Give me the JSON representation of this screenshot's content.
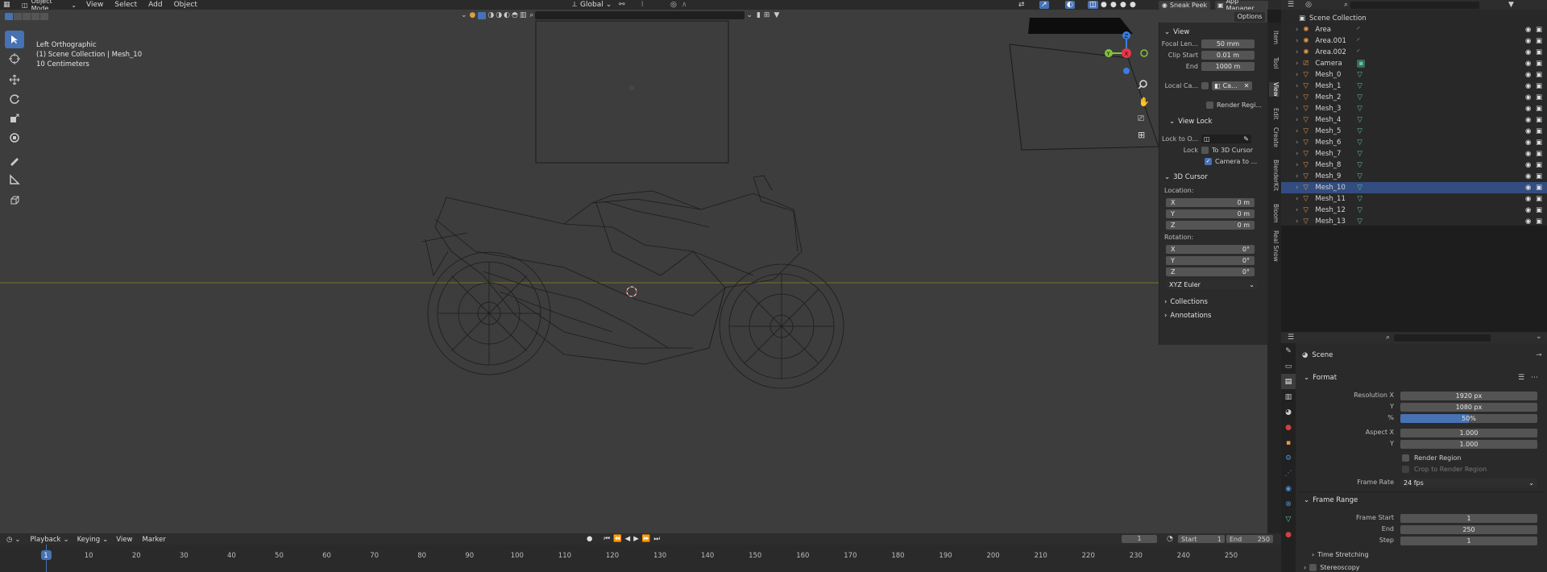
{
  "topbar": {
    "mode": "Object Mode",
    "menus": [
      "View",
      "Select",
      "Add",
      "Object"
    ],
    "transform": "Global",
    "sneak_peek": "Sneak Peek",
    "app_manager": "App Manager",
    "options": "Options"
  },
  "viewport": {
    "view_name": "Left Orthographic",
    "collection": "(1) Scene Collection | Mesh_10",
    "scale": "10 Centimeters"
  },
  "npanel": {
    "view_title": "View",
    "focal_label": "Focal Len...",
    "focal_value": "50 mm",
    "clip_start_label": "Clip Start",
    "clip_start_value": "0.01 m",
    "end_label": "End",
    "end_value": "1000 m",
    "local_camera_label": "Local Ca...",
    "local_camera_value": "Ca...",
    "render_region": "Render Regi...",
    "view_lock_title": "View Lock",
    "lock_to_label": "Lock to O...",
    "lock_label": "Lock",
    "to_3d_cursor": "To 3D Cursor",
    "camera_to": "Camera to ...",
    "cursor_title": "3D Cursor",
    "location_label": "Location:",
    "rotation_label": "Rotation:",
    "loc": [
      {
        "axis": "X",
        "value": "0 m"
      },
      {
        "axis": "Y",
        "value": "0 m"
      },
      {
        "axis": "Z",
        "value": "0 m"
      }
    ],
    "rot": [
      {
        "axis": "X",
        "value": "0°"
      },
      {
        "axis": "Y",
        "value": "0°"
      },
      {
        "axis": "Z",
        "value": "0°"
      }
    ],
    "rotation_mode": "XYZ Euler",
    "collections": "Collections",
    "annotations": "Annotations"
  },
  "sidetabs": [
    "Item",
    "Tool",
    "View",
    "Edit",
    "Create",
    "BlenderKit",
    "Bloom",
    "Real Snow"
  ],
  "outliner": {
    "root": "Scene Collection",
    "items": [
      {
        "name": "Area",
        "kind": "light"
      },
      {
        "name": "Area.001",
        "kind": "light"
      },
      {
        "name": "Area.002",
        "kind": "light"
      },
      {
        "name": "Camera",
        "kind": "camera"
      },
      {
        "name": "Mesh_0",
        "kind": "mesh"
      },
      {
        "name": "Mesh_1",
        "kind": "mesh"
      },
      {
        "name": "Mesh_2",
        "kind": "mesh"
      },
      {
        "name": "Mesh_3",
        "kind": "mesh"
      },
      {
        "name": "Mesh_4",
        "kind": "mesh"
      },
      {
        "name": "Mesh_5",
        "kind": "mesh"
      },
      {
        "name": "Mesh_6",
        "kind": "mesh"
      },
      {
        "name": "Mesh_7",
        "kind": "mesh"
      },
      {
        "name": "Mesh_8",
        "kind": "mesh"
      },
      {
        "name": "Mesh_9",
        "kind": "mesh"
      },
      {
        "name": "Mesh_10",
        "kind": "mesh",
        "selected": true
      },
      {
        "name": "Mesh_11",
        "kind": "mesh"
      },
      {
        "name": "Mesh_12",
        "kind": "mesh"
      },
      {
        "name": "Mesh_13",
        "kind": "mesh"
      }
    ]
  },
  "properties": {
    "scene": "Scene",
    "format": "Format",
    "res_x_label": "Resolution X",
    "res_x": "1920 px",
    "y_label": "Y",
    "res_y": "1080 px",
    "pct_label": "%",
    "pct": "50%",
    "aspect_x_label": "Aspect X",
    "aspect_x": "1.000",
    "aspect_y": "1.000",
    "render_region": "Render Region",
    "crop": "Crop to Render Region",
    "frame_rate_label": "Frame Rate",
    "frame_rate": "24 fps",
    "frame_range": "Frame Range",
    "frame_start_label": "Frame Start",
    "frame_start": "1",
    "end_label": "End",
    "end": "250",
    "step_label": "Step",
    "step": "1",
    "time_stretching": "Time Stretching",
    "stereoscopy": "Stereoscopy"
  },
  "timeline": {
    "playback": "Playback",
    "keying": "Keying",
    "view": "View",
    "marker": "Marker",
    "current_frame": "1",
    "start_label": "Start",
    "start": "1",
    "end_label": "End",
    "end": "250",
    "ticks": [
      "1",
      "10",
      "20",
      "30",
      "40",
      "50",
      "60",
      "70",
      "80",
      "90",
      "100",
      "110",
      "120",
      "130",
      "140",
      "150",
      "160",
      "170",
      "180",
      "190",
      "200",
      "210",
      "220",
      "230",
      "240",
      "250"
    ]
  },
  "colors": {
    "accent": "#4772b3",
    "light_icon": "#e8964a",
    "mesh_icon": "#e8964a",
    "mesh_data": "#5fc7a5",
    "axis_x": "#e8374a",
    "axis_y": "#86c33b",
    "axis_z": "#3b7de0"
  }
}
